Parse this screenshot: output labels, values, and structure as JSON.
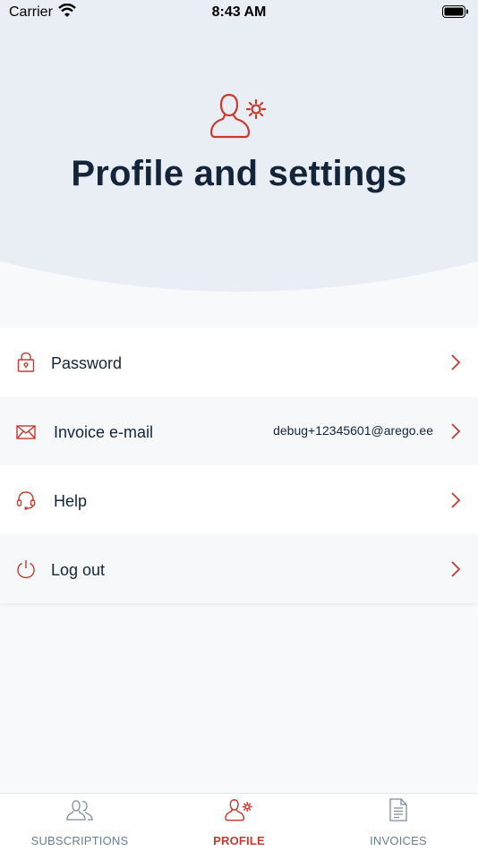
{
  "status_bar": {
    "carrier": "Carrier",
    "time": "8:43 AM"
  },
  "header": {
    "title": "Profile and settings",
    "icon": "user-gear-icon"
  },
  "menu": {
    "items": [
      {
        "label": "Password",
        "icon": "lock-icon"
      },
      {
        "label": "Invoice e-mail",
        "icon": "envelope-icon",
        "value": "debug+12345601@arego.ee"
      },
      {
        "label": "Help",
        "icon": "headset-icon"
      },
      {
        "label": "Log out",
        "icon": "power-icon"
      }
    ]
  },
  "tabbar": {
    "tabs": [
      {
        "label": "SUBSCRIPTIONS",
        "icon": "users-icon",
        "active": false
      },
      {
        "label": "PROFILE",
        "icon": "user-gear-icon",
        "active": true
      },
      {
        "label": "INVOICES",
        "icon": "document-icon",
        "active": false
      }
    ]
  },
  "colors": {
    "accent": "#c73a2f",
    "heading": "#14253a",
    "header_bg": "#e8eef4",
    "inactive_tab": "#6b7d92"
  }
}
